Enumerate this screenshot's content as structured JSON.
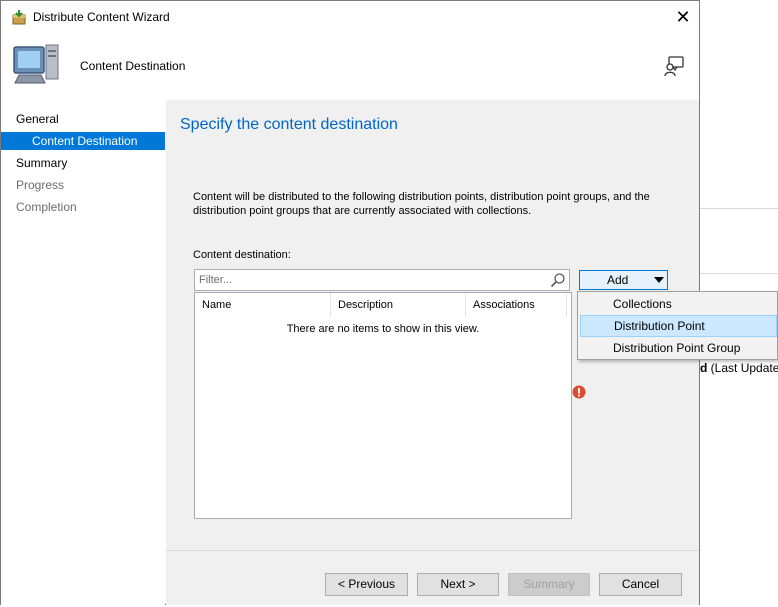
{
  "window": {
    "title": "Distribute Content Wizard",
    "close_glyph": "✕"
  },
  "header": {
    "page_title": "Content Destination"
  },
  "sidebar": {
    "items": [
      {
        "label": "General",
        "state": "normal"
      },
      {
        "label": "Content Destination",
        "state": "selected"
      },
      {
        "label": "Summary",
        "state": "normal"
      },
      {
        "label": "Progress",
        "state": "disabled"
      },
      {
        "label": "Completion",
        "state": "disabled"
      }
    ]
  },
  "main": {
    "heading": "Specify the content destination",
    "description": "Content will be distributed to the following distribution points, distribution point groups, and the distribution point groups that are currently associated with collections.",
    "destination_label": "Content destination:",
    "filter_placeholder": "Filter...",
    "columns": [
      "Name",
      "Description",
      "Associations"
    ],
    "empty_message": "There are no items to show in this view.",
    "add_label": "Add"
  },
  "add_menu": {
    "items": [
      "Collections",
      "Distribution Point",
      "Distribution Point Group"
    ],
    "hovered_index": 1
  },
  "footer": {
    "previous_label": "< Previous",
    "next_label": "Next >",
    "summary_label": "Summary",
    "cancel_label": "Cancel"
  },
  "background": {
    "bold_fragment": "d",
    "text_fragment": " (Last Update:"
  },
  "colors": {
    "accent": "#0078d7",
    "heading": "#0066cc",
    "panel": "#f0f0f0",
    "menu_hover": "#cce8ff",
    "error": "#e04a2f"
  },
  "icons": {
    "title": "content-package-icon",
    "header": "computer-monitor-icon",
    "help": "help-person-icon",
    "search": "search-icon",
    "dropdown": "dropdown-arrow-icon",
    "error": "error-icon"
  }
}
